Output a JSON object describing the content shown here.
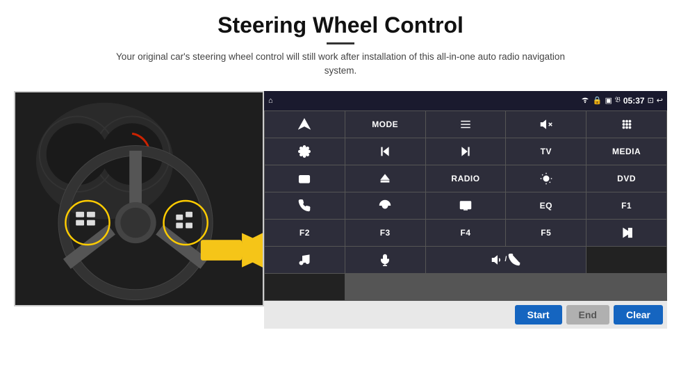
{
  "page": {
    "title": "Steering Wheel Control",
    "subtitle": "Your original car's steering wheel control will still work after installation of this all-in-one auto radio navigation system."
  },
  "status_bar": {
    "time": "05:37",
    "icons": [
      "wifi",
      "lock",
      "sim",
      "bluetooth",
      "battery",
      "screen",
      "back"
    ]
  },
  "buttons": [
    {
      "id": "nav",
      "type": "icon",
      "icon": "navigate"
    },
    {
      "id": "mode",
      "type": "text",
      "label": "MODE"
    },
    {
      "id": "list",
      "type": "icon",
      "icon": "list"
    },
    {
      "id": "mute",
      "type": "icon",
      "icon": "mute"
    },
    {
      "id": "apps",
      "type": "icon",
      "icon": "apps"
    },
    {
      "id": "settings",
      "type": "icon",
      "icon": "settings"
    },
    {
      "id": "prev",
      "type": "icon",
      "icon": "prev"
    },
    {
      "id": "next",
      "type": "icon",
      "icon": "next"
    },
    {
      "id": "tv",
      "type": "text",
      "label": "TV"
    },
    {
      "id": "media",
      "type": "text",
      "label": "MEDIA"
    },
    {
      "id": "cam360",
      "type": "icon",
      "icon": "360cam"
    },
    {
      "id": "eject",
      "type": "icon",
      "icon": "eject"
    },
    {
      "id": "radio",
      "type": "text",
      "label": "RADIO"
    },
    {
      "id": "brightness",
      "type": "icon",
      "icon": "brightness"
    },
    {
      "id": "dvd",
      "type": "text",
      "label": "DVD"
    },
    {
      "id": "phone",
      "type": "icon",
      "icon": "phone"
    },
    {
      "id": "swipe",
      "type": "icon",
      "icon": "swipe"
    },
    {
      "id": "screen",
      "type": "icon",
      "icon": "screen"
    },
    {
      "id": "eq",
      "type": "text",
      "label": "EQ"
    },
    {
      "id": "f1",
      "type": "text",
      "label": "F1"
    },
    {
      "id": "f2",
      "type": "text",
      "label": "F2"
    },
    {
      "id": "f3",
      "type": "text",
      "label": "F3"
    },
    {
      "id": "f4",
      "type": "text",
      "label": "F4"
    },
    {
      "id": "f5",
      "type": "text",
      "label": "F5"
    },
    {
      "id": "playpause",
      "type": "icon",
      "icon": "playpause"
    },
    {
      "id": "music",
      "type": "icon",
      "icon": "music"
    },
    {
      "id": "mic",
      "type": "icon",
      "icon": "mic"
    },
    {
      "id": "volphone",
      "type": "icon",
      "icon": "volphone"
    }
  ],
  "bottom_bar": {
    "start_label": "Start",
    "end_label": "End",
    "clear_label": "Clear"
  }
}
